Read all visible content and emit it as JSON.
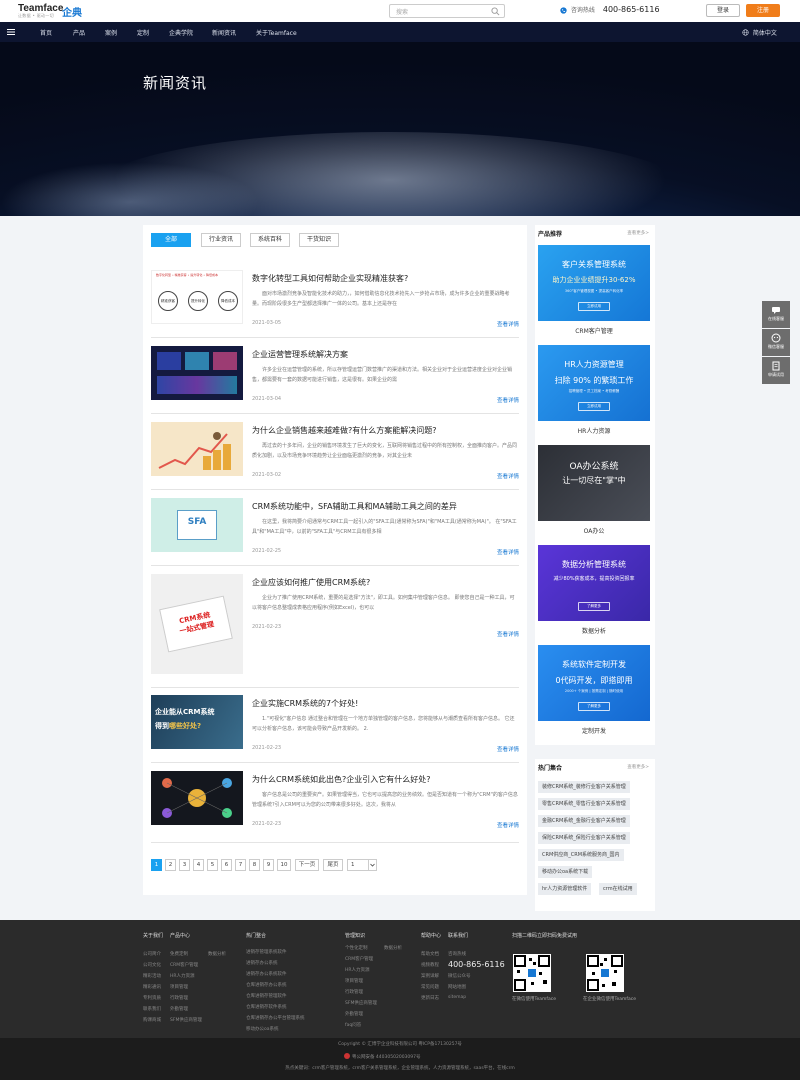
{
  "header": {
    "logo": "Teamface",
    "logo_sub": "让数据 • 驱动一切",
    "logo_cn": "企典",
    "search_placeholder": "搜索",
    "hotline_label": "咨询热线",
    "hotline_number": "400-865-6116",
    "login": "登录",
    "register": "注册"
  },
  "nav": {
    "items": [
      "首页",
      "产品",
      "案例",
      "定制",
      "企典学院",
      "新闻资讯",
      "关于Teamface"
    ],
    "lang": "简体中文"
  },
  "banner": {
    "title": "新闻资讯"
  },
  "tabs": [
    "全部",
    "行业资讯",
    "系统百科",
    "干货知识"
  ],
  "articles": [
    {
      "title": "数字化转型工具如何帮助企业实现精准获客?",
      "summary": "面对市场激烈竞争及智能化技术的助力，，如何借助信息化技术抢先入一步抢占市场，成为许多企业的重要战略考量。而现阶段很多生产型都选择推广一体的公司。基本上还是存在",
      "date": "2021-03-05",
      "more": "查看详情"
    },
    {
      "title": "企业运营管理系统解决方案",
      "summary": "许多企业在运营管理的系统，所以存管理运营门数营推广的渠道和方法。相关企业对于企业运营进度企业对企业销售，都需要有一套的数据可能进行销售，这是很有。如果企业的需",
      "date": "2021-03-04",
      "more": "查看详情"
    },
    {
      "title": "为什么企业销售越来越难做?有什么方案能解决问题?",
      "summary": "再过去的十多年间，企业的销售环境发生了巨大的变化，互联网将销售过程中的所有控制权，全面推向客户。产品同质化加剧，以及市场竞争环境趋势让企业面临更激烈的竞争，对其企业未",
      "date": "2021-03-02",
      "more": "查看详情"
    },
    {
      "title": "CRM系统功能中，SFA辅助工具和MA辅助工具之间的差异",
      "summary": "在这里，我将简要介绍通常与CRM工具一起引入的\"SFA工具(通常称为SFA)\"和\"MA工具(通常称为MA)\"。      在\"SFA工具\"和\"MA工具\"中，以前的\"SFA工具\"与CRM工具有很多相",
      "date": "2021-02-25",
      "more": "查看详情"
    },
    {
      "title": "企业应该如何推广使用CRM系统?",
      "summary": "企业为了推广使用CRM系统，重要的是选择\"方法\"，即工具。如何集中管理客户信息。      即使您自己是一种工具，可以将客户信息整理成表格应用程序(例如Excel)，也可以",
      "date": "2021-02-23",
      "more": "查看详情"
    },
    {
      "title": "企业实施CRM系统的7个好处!",
      "summary": "1.\"可视化\"客户信息      通过整合和管理在一个地方单独管理的客户信息，您将能够从与潮质查看所有客户信息。      它还可以分析客户信息，该可能会导致产品开发新的。      2.",
      "date": "2021-02-23",
      "more": "查看详情"
    },
    {
      "title": "为什么CRM系统如此出色?企业引入它有什么好处?",
      "summary": "客户信息是公司的重要资产。如果管理得当，它也可以提高您的业务绩效。但是否知道有一个称为\"CRM\"的客户信息管理系统?引入CRM可以为您的公司带来很多好处。这次，我将从",
      "date": "2021-02-23",
      "more": "查看详情"
    }
  ],
  "thumbs": {
    "t1": {
      "header": "数字化转型 • 精准获客 • 提升转化 • 降低成本",
      "c1": "精准获客",
      "c2": "提升转化",
      "c3": "降低成本"
    },
    "t4": {
      "sfa": "SFA"
    },
    "t5": {
      "l1": "CRM系统",
      "l2": "一站式管理"
    },
    "t6": {
      "l1": "企业能从CRM系统",
      "l2": "得到",
      "l3": "哪些好处?"
    }
  },
  "pagination": {
    "pages": [
      "1",
      "2",
      "3",
      "4",
      "5",
      "6",
      "7",
      "8",
      "9",
      "10"
    ],
    "next": "下一页",
    "last": "尾页",
    "current": "1"
  },
  "sidebar": {
    "products_title": "产品推荐",
    "more": "查看更多>",
    "products": [
      {
        "l1": "客户关系管理系统",
        "l2": "助力企业业绩提升30-62%",
        "l3": "360°客户管理视图 • 提高客户转化率",
        "btn": "立即试用",
        "label": "CRM客户管理",
        "bg": "#1f8fe6"
      },
      {
        "l1": "HR人力资源管理",
        "l2": "扫除 90% 的繁琐工作",
        "l3": "招聘管理 • 员工档案 • 考勤薪酬",
        "btn": "立即试用",
        "label": "HR人力资源",
        "bg": "#1c86e0"
      },
      {
        "l1": "OA办公系统",
        "l2": "让一切尽在\"掌\"中",
        "l3": "",
        "btn": "",
        "label": "OA办公",
        "bg": "#3a3d44"
      },
      {
        "l1": "数据分析管理系统",
        "l2": "减少80%获客成本，提高投资回报率",
        "l3": "",
        "btn": "了解更多",
        "label": "数据分析",
        "bg": "#4a2fc0"
      },
      {
        "l1": "系统软件定制开发",
        "l2": "0代码开发，即搭即用",
        "l3": "2000+ 个案例 | 按需定制 | 随时使用",
        "btn": "了解更多",
        "label": "定制开发",
        "bg": "#1a7ee3"
      }
    ],
    "tags_title": "热门集合",
    "tags": [
      "装修CRM系统_装修行业客户关系管理",
      "零售CRM系统_零售行业客户关系管理",
      "金融CRM系统_金融行业客户关系管理",
      "保险CRM系统_保险行业客户关系管理",
      "CRM供应商_CRM系统服务商_国内",
      "移动办公oa系统下载",
      "hr人力资源管理软件",
      "crm在线试用"
    ]
  },
  "floating": [
    "在线客服",
    "微信客服",
    "申请试用"
  ],
  "footer": {
    "col1_head": "关于我们",
    "col1": [
      "公司简介",
      "公司文化",
      "精彩活动",
      "精彩通讯",
      "专利资质",
      "联系我们",
      "购课商城"
    ],
    "col2_head": "产品中心",
    "col2": [
      "免费定制",
      "CRM客户管理",
      "HR人力资源",
      "项目管理",
      "行政管理",
      "外勤管理",
      "SFM供应商管理"
    ],
    "col2b": [
      "数据分析"
    ],
    "col3_head": "热门整合",
    "col3": [
      "进销存管理系统软件",
      "进销存办公系统",
      "进销存办公系统软件",
      "仓库进销存办公系统",
      "仓库进销存管理软件",
      "仓库进销存软件系统",
      "仓库进销存办公平台管理系统",
      "移动办公系统_移动办公管理软件",
      "移动办公oa系统"
    ],
    "col4_head": "管理知识",
    "col4": [
      "个性化定制",
      "CRM客户管理",
      "HR人力资源",
      "项目管理",
      "行政管理",
      "SFM供应商管理",
      "外勤管理",
      "faq问答"
    ],
    "col4b": [
      "数据分析"
    ],
    "col5_head": "帮助中心",
    "col5": [
      "帮助文档",
      "视频教程",
      "案例详解",
      "常见问题",
      "更新日志"
    ],
    "col6_head": "联系我们",
    "col6": [
      "咨询热线"
    ],
    "phone": "400-865-6116",
    "col6b": [
      "微信公众号",
      "网站地图",
      "sitemap"
    ],
    "qr_head": "扫描二维码立即扫码免费试用",
    "qr1": "在微信使用Teamface",
    "qr2": "在企业微信使用Teamface",
    "copyright": "Copyright © 汇博学企业科技有限公司 粤ICP备17130257号",
    "police": "粤公网安备 44030502003097号",
    "keywords": "热点关键词：crm客户管理系统，crm客户关系管理系统，企业管理系统，人力资源管理系统，saas平台，在线crm"
  }
}
